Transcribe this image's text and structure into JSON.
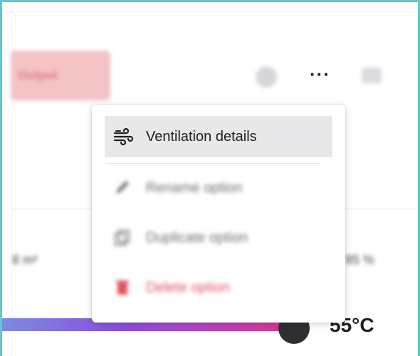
{
  "header": {
    "output_chip_label": "Output",
    "more_label": "···"
  },
  "metrics": {
    "area_value": "8 m² ",
    "percent_value": "85 %"
  },
  "slider": {
    "temperature_label": "55°C",
    "gradient_colors": [
      "#7b8be0",
      "#8a4fe0",
      "#c13fb8",
      "#e0357f"
    ]
  },
  "menu": {
    "items": [
      {
        "label": "Ventilation details",
        "icon": "wind-icon"
      },
      {
        "label": "Rename option",
        "icon": "pencil-icon"
      },
      {
        "label": "Duplicate option",
        "icon": "duplicate-icon"
      },
      {
        "label": "Delete option",
        "icon": "trash-icon"
      }
    ]
  },
  "colors": {
    "frame_border": "#5fc9cf",
    "chip_bg": "#f3c3c6",
    "danger": "#e0535d"
  }
}
